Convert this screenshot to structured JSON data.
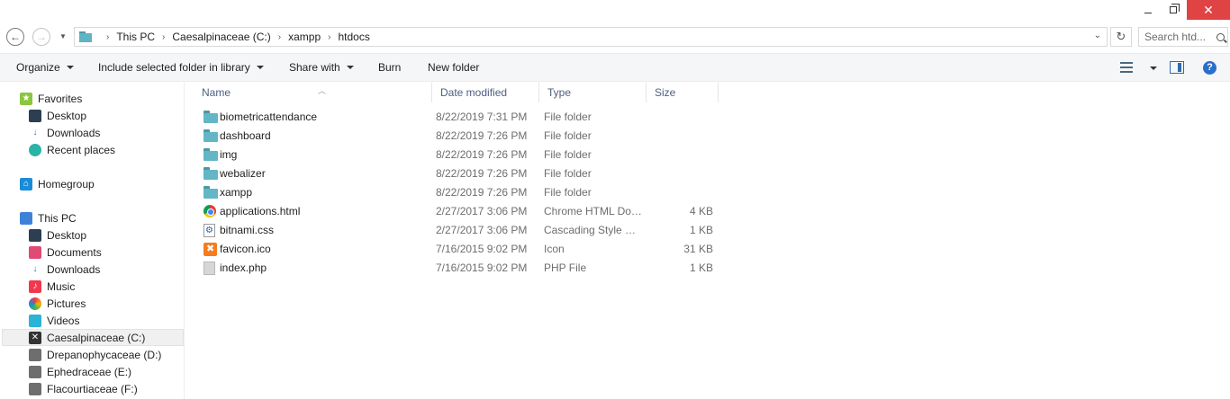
{
  "window": {
    "minimize_icon": "minimize-icon",
    "maximize_icon": "restore-icon",
    "close_icon": "close-icon"
  },
  "address": {
    "back_icon": "back-arrow-icon",
    "forward_icon": "forward-arrow-icon",
    "crumbs": [
      "This PC",
      "Caesalpinaceae (C:)",
      "xampp",
      "htdocs"
    ],
    "search_placeholder": "Search htd..."
  },
  "toolbar": {
    "organize": "Organize",
    "include": "Include selected folder in library",
    "share": "Share with",
    "burn": "Burn",
    "new_folder": "New folder"
  },
  "navpane": {
    "favorites": "Favorites",
    "fav_items": [
      "Desktop",
      "Downloads",
      "Recent places"
    ],
    "homegroup": "Homegroup",
    "thispc": "This PC",
    "pc_items": [
      "Desktop",
      "Documents",
      "Downloads",
      "Music",
      "Pictures",
      "Videos",
      "Caesalpinaceae (C:)",
      "Drepanophycaceae (D:)",
      "Ephedraceae (E:)",
      "Flacourtiaceae (F:)"
    ]
  },
  "columns": {
    "name": "Name",
    "date": "Date modified",
    "type": "Type",
    "size": "Size"
  },
  "files": [
    {
      "name": "biometricattendance",
      "date": "8/22/2019 7:31 PM",
      "type": "File folder",
      "size": "",
      "icon": "folder-icon"
    },
    {
      "name": "dashboard",
      "date": "8/22/2019 7:26 PM",
      "type": "File folder",
      "size": "",
      "icon": "folder-icon"
    },
    {
      "name": "img",
      "date": "8/22/2019 7:26 PM",
      "type": "File folder",
      "size": "",
      "icon": "folder-icon"
    },
    {
      "name": "webalizer",
      "date": "8/22/2019 7:26 PM",
      "type": "File folder",
      "size": "",
      "icon": "folder-icon"
    },
    {
      "name": "xampp",
      "date": "8/22/2019 7:26 PM",
      "type": "File folder",
      "size": "",
      "icon": "folder-icon"
    },
    {
      "name": "applications.html",
      "date": "2/27/2017 3:06 PM",
      "type": "Chrome HTML Doc...",
      "size": "4 KB",
      "icon": "chrome-icon"
    },
    {
      "name": "bitnami.css",
      "date": "2/27/2017 3:06 PM",
      "type": "Cascading Style Sh...",
      "size": "1 KB",
      "icon": "css-icon"
    },
    {
      "name": "favicon.ico",
      "date": "7/16/2015 9:02 PM",
      "type": "Icon",
      "size": "31 KB",
      "icon": "ico-icon"
    },
    {
      "name": "index.php",
      "date": "7/16/2015 9:02 PM",
      "type": "PHP File",
      "size": "1 KB",
      "icon": "php-icon"
    }
  ]
}
